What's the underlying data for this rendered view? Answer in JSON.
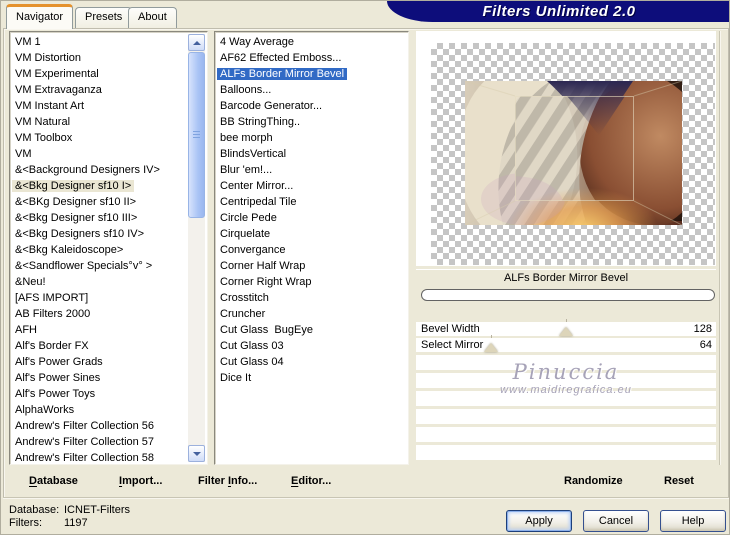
{
  "colors": {
    "accent_navy": "#0d0d7b",
    "selection_blue": "#316ac5",
    "tab_orange": "#e5922d",
    "watermark": "#a7a3b8",
    "dialog_beige": "#ece9d8",
    "checker_gray": "#c5c5c5"
  },
  "banner": {
    "title": "Filters Unlimited 2.0"
  },
  "tabs": [
    {
      "label": "Navigator",
      "active": true
    },
    {
      "label": "Presets",
      "active": false
    },
    {
      "label": "About",
      "active": false
    }
  ],
  "category_list": {
    "selected_index": 9,
    "items": [
      "VM 1",
      "VM Distortion",
      "VM Experimental",
      "VM Extravaganza",
      "VM Instant Art",
      "VM Natural",
      "VM Toolbox",
      "VM",
      "&<Background Designers IV>",
      "&<Bkg Designer sf10 I>",
      "&<BKg Designer sf10 II>",
      "&<Bkg Designer sf10 III>",
      "&<Bkg Designers sf10 IV>",
      "&<Bkg Kaleidoscope>",
      "&<Sandflower Specials°v° >",
      "&Neu!",
      "[AFS IMPORT]",
      "AB Filters 2000",
      "AFH",
      "Alf's Border FX",
      "Alf's Power Grads",
      "Alf's Power Sines",
      "Alf's Power Toys",
      "AlphaWorks",
      "Andrew's Filter Collection 56",
      "Andrew's Filter Collection 57",
      "Andrew's Filter Collection 58"
    ]
  },
  "filter_list": {
    "selected_index": 2,
    "items": [
      "4 Way Average",
      "AF62 Effected Emboss...",
      "ALFs Border Mirror Bevel",
      "Balloons...",
      "Barcode Generator...",
      "BB StringThing..",
      "bee morph",
      "BlindsVertical",
      "Blur 'em!...",
      "Center Mirror...",
      "Centripedal Tile",
      "Circle Pede",
      "Cirquelate",
      "Convergance",
      "Corner Half Wrap",
      "Corner Right Wrap",
      "Crosstitch",
      "Cruncher",
      "Cut Glass  BugEye",
      "Cut Glass 03",
      "Cut Glass 04",
      "Dice It"
    ]
  },
  "preview": {
    "caption": "ALFs Border Mirror Bevel",
    "progress_value": 0,
    "watermark_name": "Pinuccia",
    "watermark_url": "www.maidiregrafica.eu",
    "empty_rows": 6
  },
  "sliders": [
    {
      "label": "Bevel Width",
      "value": "128",
      "thumb_pct": 50
    },
    {
      "label": "Select Mirror",
      "value": "64",
      "thumb_pct": 25
    }
  ],
  "toolbar": [
    {
      "label": "Database",
      "underline": 0
    },
    {
      "label": "Import...",
      "underline": 0
    },
    {
      "label": "Filter Info...",
      "underline": 7
    },
    {
      "label": "Editor...",
      "underline": 0
    },
    {
      "label": "Randomize",
      "underline": -1
    },
    {
      "label": "Reset",
      "underline": -1
    }
  ],
  "status": [
    {
      "label": "Database:",
      "value": "ICNET-Filters"
    },
    {
      "label": "Filters:",
      "value": "1197"
    }
  ],
  "dialog_buttons": [
    {
      "label": "Apply",
      "default": true
    },
    {
      "label": "Cancel",
      "default": false
    },
    {
      "label": "Help",
      "default": false
    }
  ]
}
